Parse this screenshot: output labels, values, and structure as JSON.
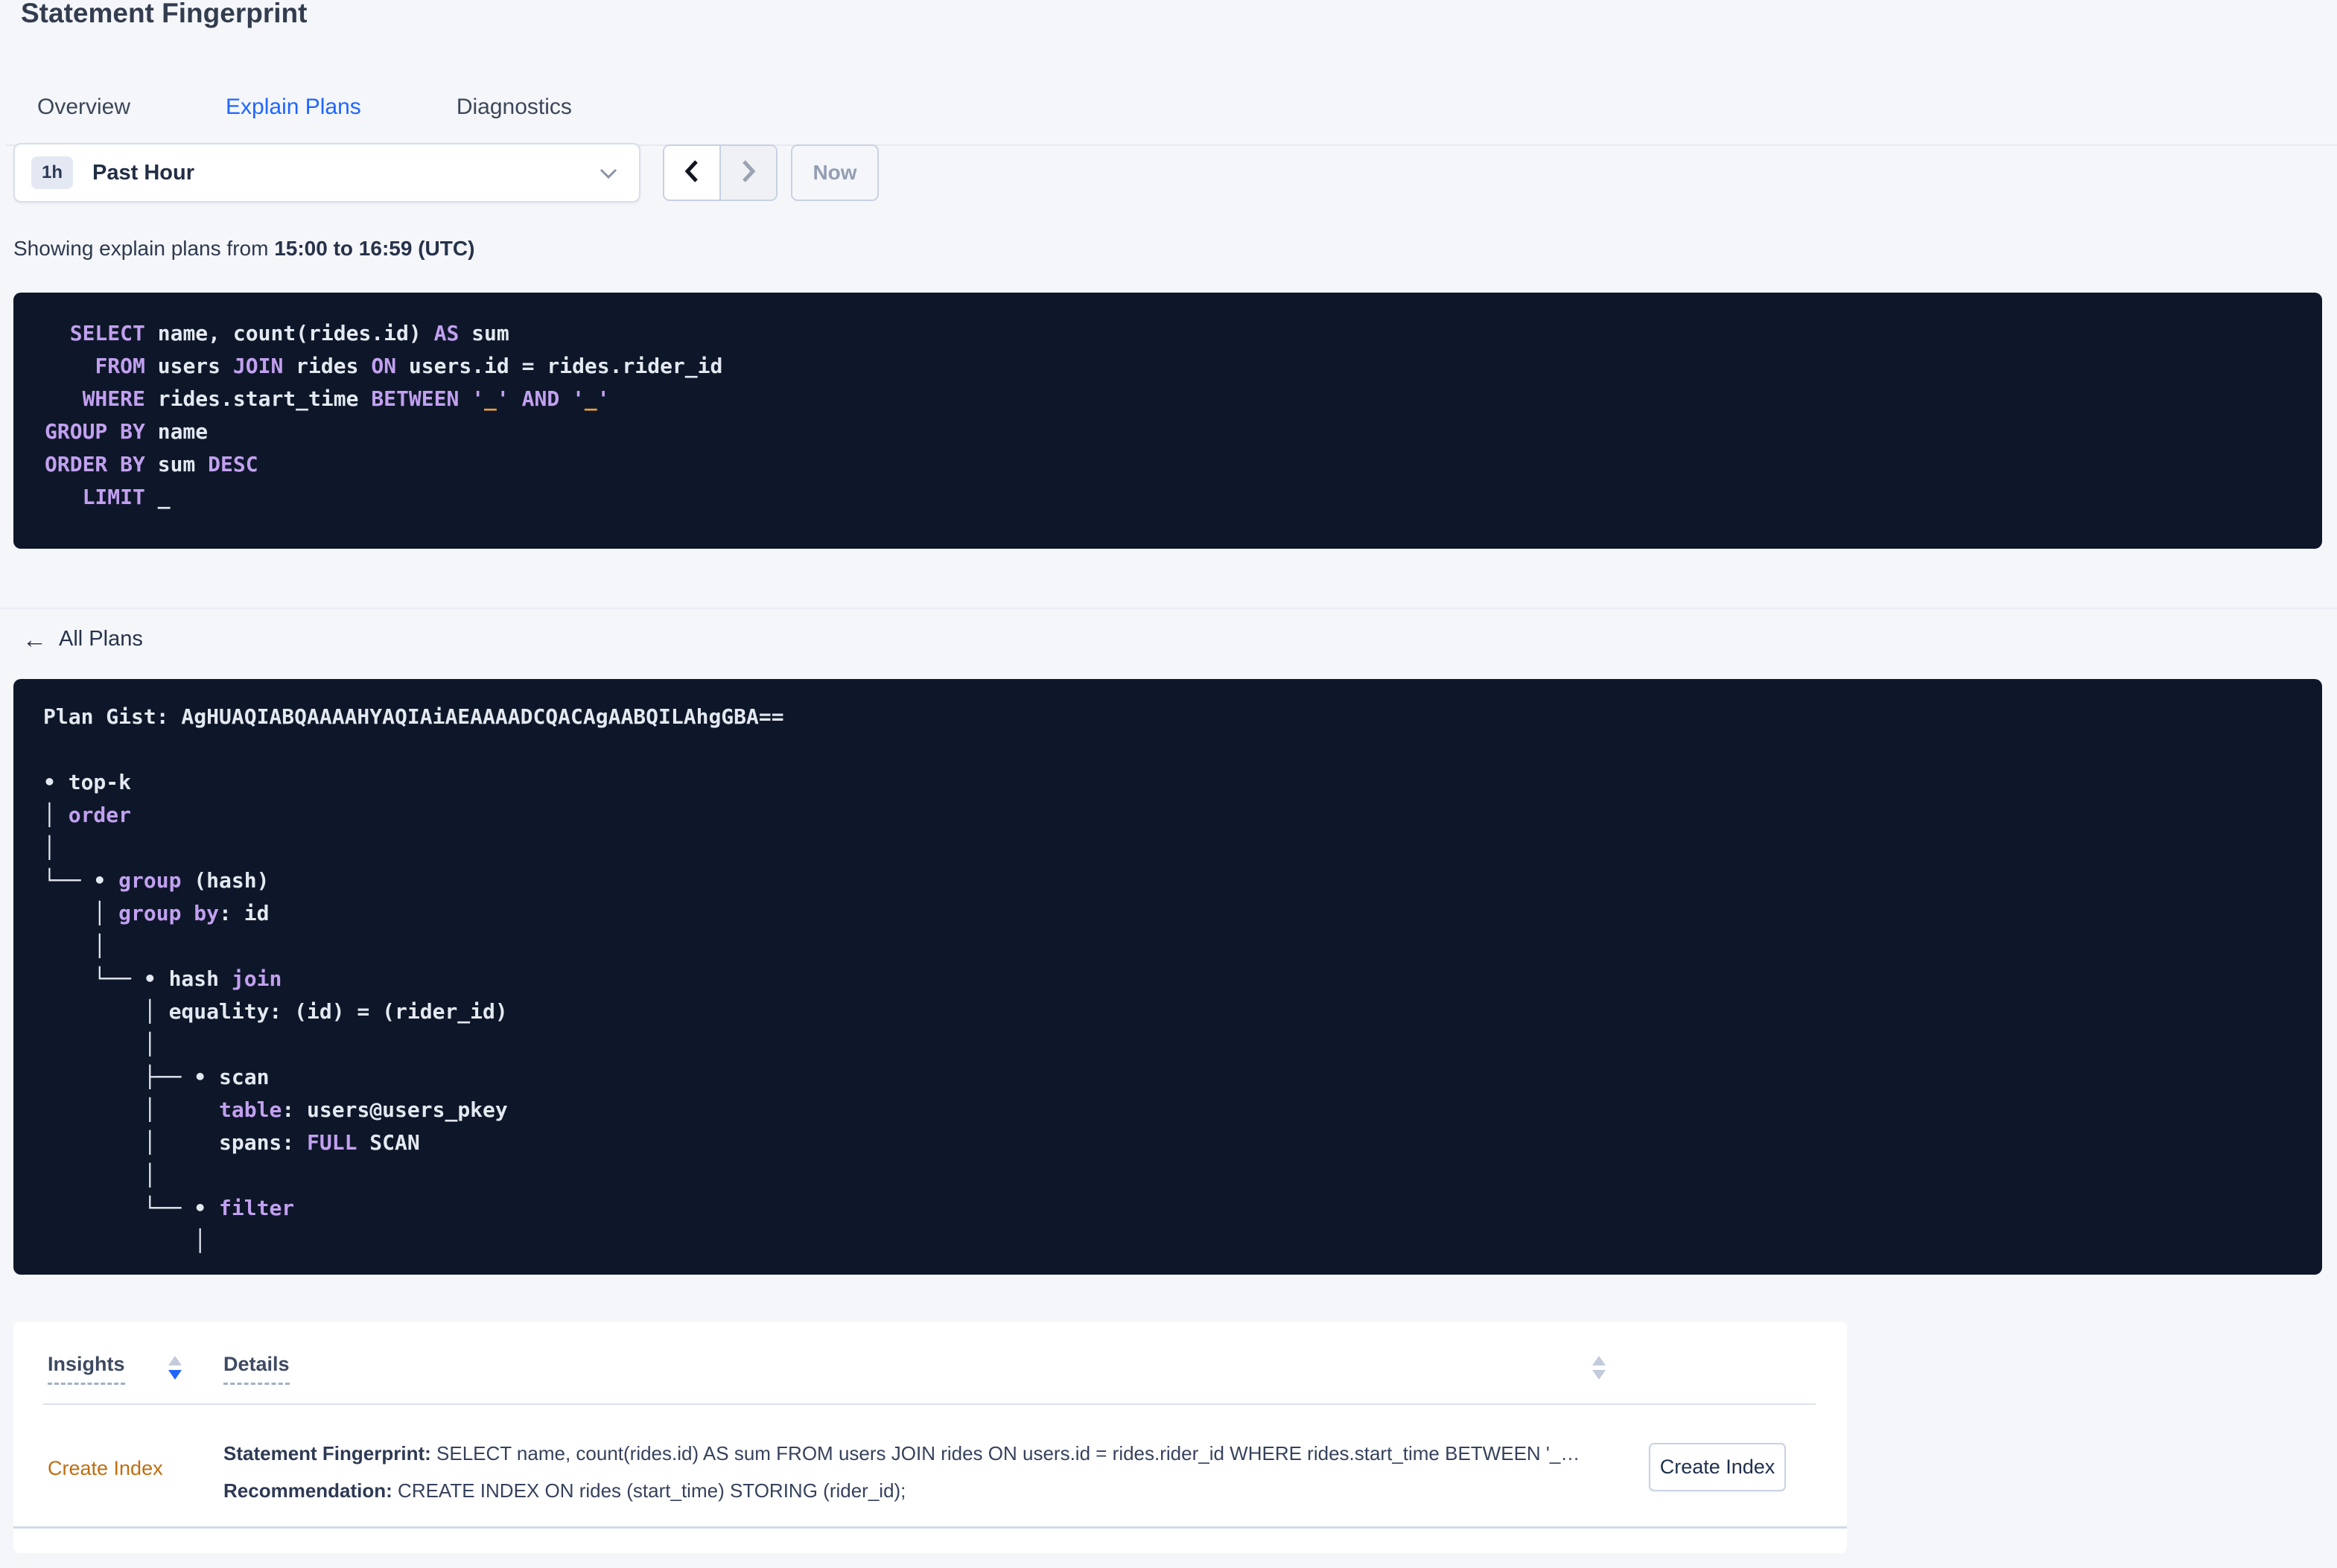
{
  "header": {
    "title": "Statement Fingerprint"
  },
  "tabs": [
    {
      "label": "Overview"
    },
    {
      "label": "Explain Plans"
    },
    {
      "label": "Diagnostics"
    }
  ],
  "timebar": {
    "range_badge": "1h",
    "range_label": "Past Hour",
    "now_label": "Now"
  },
  "showing": {
    "prefix": "Showing explain plans from ",
    "range": "15:00 to 16:59 (UTC)"
  },
  "sql_block": {
    "lines": [
      [
        {
          "c": "pl",
          "t": "  "
        },
        {
          "c": "kw",
          "t": "SELECT"
        },
        {
          "c": "pl",
          "t": " name, count(rides.id) "
        },
        {
          "c": "kw",
          "t": "AS"
        },
        {
          "c": "pl",
          "t": " sum"
        }
      ],
      [
        {
          "c": "pl",
          "t": "    "
        },
        {
          "c": "kw",
          "t": "FROM"
        },
        {
          "c": "pl",
          "t": " users "
        },
        {
          "c": "kw",
          "t": "JOIN"
        },
        {
          "c": "pl",
          "t": " rides "
        },
        {
          "c": "kw",
          "t": "ON"
        },
        {
          "c": "pl",
          "t": " users.id = rides.rider_id"
        }
      ],
      [
        {
          "c": "pl",
          "t": "   "
        },
        {
          "c": "kw",
          "t": "WHERE"
        },
        {
          "c": "pl",
          "t": " rides.start_time "
        },
        {
          "c": "kw",
          "t": "BETWEEN"
        },
        {
          "c": "pl",
          "t": " "
        },
        {
          "c": "kw",
          "t": "'"
        },
        {
          "c": "str",
          "t": "_"
        },
        {
          "c": "kw",
          "t": "'"
        },
        {
          "c": "pl",
          "t": " "
        },
        {
          "c": "kw",
          "t": "AND"
        },
        {
          "c": "pl",
          "t": " "
        },
        {
          "c": "kw",
          "t": "'"
        },
        {
          "c": "str",
          "t": "_"
        },
        {
          "c": "kw",
          "t": "'"
        }
      ],
      [
        {
          "c": "kw",
          "t": "GROUP BY"
        },
        {
          "c": "pl",
          "t": " name"
        }
      ],
      [
        {
          "c": "kw",
          "t": "ORDER BY"
        },
        {
          "c": "pl",
          "t": " sum "
        },
        {
          "c": "kw",
          "t": "DESC"
        }
      ],
      [
        {
          "c": "pl",
          "t": "   "
        },
        {
          "c": "kw",
          "t": "LIMIT"
        },
        {
          "c": "pl",
          "t": " _"
        }
      ]
    ]
  },
  "nav": {
    "all_plans": "All Plans"
  },
  "plan_block": {
    "lines": [
      [
        {
          "c": "pl",
          "t": "Plan Gist: AgHUAQIABQAAAAHYAQIAiAEAAAADCQACAgAABQILAhgGBA=="
        }
      ],
      [],
      [
        {
          "c": "pl",
          "t": "• top-k"
        }
      ],
      [
        {
          "c": "pl",
          "t": "│ "
        },
        {
          "c": "kw",
          "t": "order"
        }
      ],
      [
        {
          "c": "pl",
          "t": "│"
        }
      ],
      [
        {
          "c": "pl",
          "t": "└── • "
        },
        {
          "c": "kw",
          "t": "group"
        },
        {
          "c": "pl",
          "t": " (hash)"
        }
      ],
      [
        {
          "c": "pl",
          "t": "    │ "
        },
        {
          "c": "kw",
          "t": "group by"
        },
        {
          "c": "pl",
          "t": ": id"
        }
      ],
      [
        {
          "c": "pl",
          "t": "    │"
        }
      ],
      [
        {
          "c": "pl",
          "t": "    └── • hash "
        },
        {
          "c": "kw",
          "t": "join"
        }
      ],
      [
        {
          "c": "pl",
          "t": "        │ equality: (id) = (rider_id)"
        }
      ],
      [
        {
          "c": "pl",
          "t": "        │"
        }
      ],
      [
        {
          "c": "pl",
          "t": "        ├── • scan"
        }
      ],
      [
        {
          "c": "pl",
          "t": "        │     "
        },
        {
          "c": "kw",
          "t": "table"
        },
        {
          "c": "pl",
          "t": ": users@users_pkey"
        }
      ],
      [
        {
          "c": "pl",
          "t": "        │     spans: "
        },
        {
          "c": "kw",
          "t": "FULL"
        },
        {
          "c": "pl",
          "t": " SCAN"
        }
      ],
      [
        {
          "c": "pl",
          "t": "        │"
        }
      ],
      [
        {
          "c": "pl",
          "t": "        └── • "
        },
        {
          "c": "kw",
          "t": "filter"
        }
      ],
      [
        {
          "c": "pl",
          "t": "            │"
        }
      ]
    ]
  },
  "insights_table": {
    "columns": [
      {
        "label": "Insights"
      },
      {
        "label": "Details"
      }
    ],
    "row": {
      "insight": "Create Index",
      "detail1_label": "Statement Fingerprint:",
      "detail1_text": " SELECT name, count(rides.id) AS sum FROM users JOIN rides ON users.id = rides.rider_id WHERE rides.start_time BETWEEN '_…",
      "detail2_label": "Recommendation:",
      "detail2_text": " CREATE INDEX ON rides (start_time) STORING (rider_id);",
      "action_label": "Create Index"
    }
  },
  "colors": {
    "accent_blue": "#2065ff",
    "insight_orange": "#bf6e11",
    "code_keyword_purple": "#c2a0f0",
    "code_literal_orange": "#efa13b",
    "code_background": "#0e1729"
  }
}
